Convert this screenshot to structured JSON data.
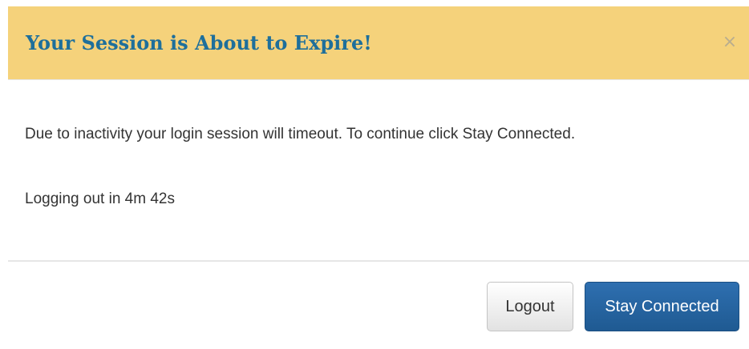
{
  "modal": {
    "title": "Your Session is About to Expire!",
    "close_label": "×",
    "close_icon": "close-icon",
    "message": "Due to inactivity your login session will timeout. To continue click Stay Connected.",
    "countdown_text": "Logging out in 4m 42s"
  },
  "footer": {
    "logout_label": "Logout",
    "stay_connected_label": "Stay Connected"
  },
  "colors": {
    "header_background": "#f5d27b",
    "title_text": "#1e6f9b",
    "primary_button": "#1f5a92"
  }
}
